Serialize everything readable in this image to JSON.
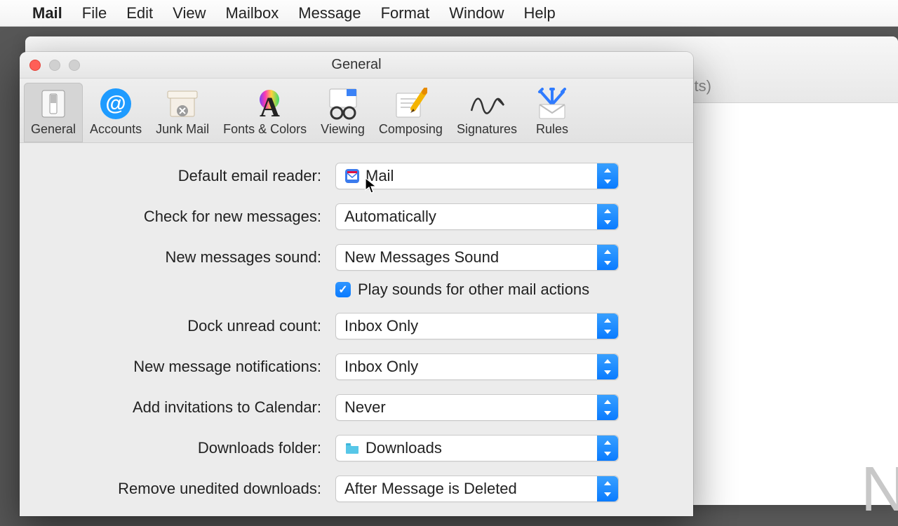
{
  "menubar": {
    "app": "Mail",
    "items": [
      "File",
      "Edit",
      "View",
      "Mailbox",
      "Message",
      "Format",
      "Window",
      "Help"
    ]
  },
  "background": {
    "toolbar_fragment": "ts)",
    "content_fragment": "N"
  },
  "prefs": {
    "title": "General",
    "active_tab": 0,
    "tabs": [
      {
        "label": "General",
        "icon": "switch-icon"
      },
      {
        "label": "Accounts",
        "icon": "at-icon"
      },
      {
        "label": "Junk Mail",
        "icon": "junk-icon"
      },
      {
        "label": "Fonts & Colors",
        "icon": "fonts-icon"
      },
      {
        "label": "Viewing",
        "icon": "viewing-icon"
      },
      {
        "label": "Composing",
        "icon": "composing-icon"
      },
      {
        "label": "Signatures",
        "icon": "signatures-icon"
      },
      {
        "label": "Rules",
        "icon": "rules-icon"
      }
    ],
    "fields": {
      "default_reader": {
        "label": "Default email reader:",
        "value": "Mail",
        "leading_icon": "mail-app-icon"
      },
      "check_messages": {
        "label": "Check for new messages:",
        "value": "Automatically"
      },
      "new_msg_sound": {
        "label": "New messages sound:",
        "value": "New Messages Sound"
      },
      "play_sounds": {
        "label": "Play sounds for other mail actions",
        "checked": true
      },
      "dock_unread": {
        "label": "Dock unread count:",
        "value": "Inbox Only"
      },
      "notifications": {
        "label": "New message notifications:",
        "value": "Inbox Only"
      },
      "calendar_invites": {
        "label": "Add invitations to Calendar:",
        "value": "Never"
      },
      "downloads_folder": {
        "label": "Downloads folder:",
        "value": "Downloads",
        "leading_icon": "folder-icon"
      },
      "remove_downloads": {
        "label": "Remove unedited downloads:",
        "value": "After Message is Deleted"
      }
    }
  }
}
